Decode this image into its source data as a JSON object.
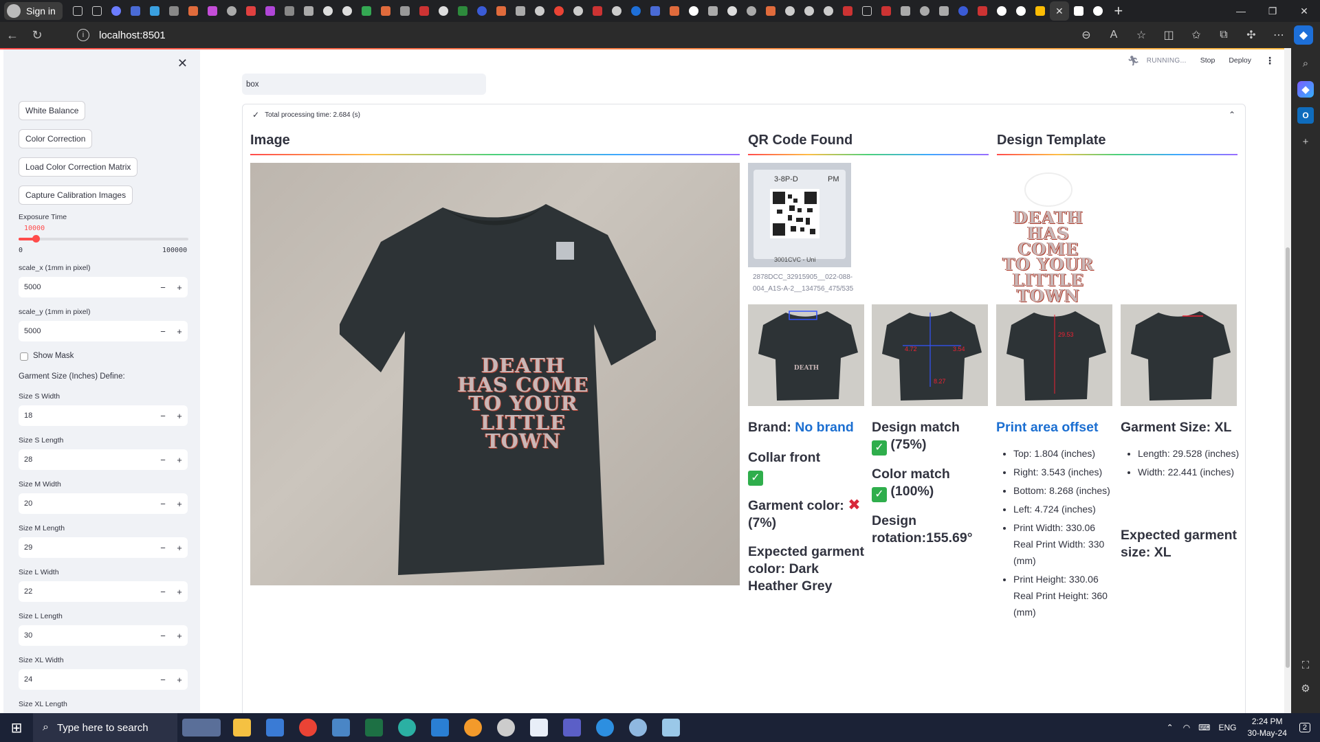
{
  "browser": {
    "sign_in": "Sign in",
    "url": "localhost:8501",
    "new_tab": "+"
  },
  "app": {
    "status": "RUNNING...",
    "stop": "Stop",
    "deploy": "Deploy",
    "search_value": "box",
    "processing_time": "Total processing time: 2.684 (s)"
  },
  "sidebar": {
    "buttons": [
      "White Balance",
      "Color Correction",
      "Load Color Correction Matrix",
      "Capture Calibration Images"
    ],
    "exposure_label": "Exposure Time",
    "exposure_value": "10000",
    "exposure_min": "0",
    "exposure_max": "100000",
    "exposure_fraction": 0.1,
    "scale_x_label": "scale_x (1mm in pixel)",
    "scale_x_value": "5000",
    "scale_y_label": "scale_y (1mm in pixel)",
    "scale_y_value": "5000",
    "show_mask": "Show Mask",
    "garment_section": "Garment Size (Inches) Define:",
    "sizes": [
      {
        "label": "Size S Width",
        "value": "18"
      },
      {
        "label": "Size S Length",
        "value": "28"
      },
      {
        "label": "Size M Width",
        "value": "20"
      },
      {
        "label": "Size M Length",
        "value": "29"
      },
      {
        "label": "Size L Width",
        "value": "22"
      },
      {
        "label": "Size L Length",
        "value": "30"
      },
      {
        "label": "Size XL Width",
        "value": "24"
      }
    ],
    "size_xl_length_label": "Size XL Length"
  },
  "columns": {
    "image": "Image",
    "qr": "QR Code Found",
    "template": "Design Template"
  },
  "qr_caption": "2878DCC_32915905__022-088-004_A1S-A-2__134756_475/535",
  "qr_text_top": "3-8P-D",
  "qr_text_pm": "PM",
  "qr_text_bottom": "3001CVC - Uni",
  "print_lines": [
    "DEATH",
    "HAS COME",
    "TO YOUR",
    "LITTLE TOWN"
  ],
  "thumb_labels": {
    "t2_a": "4.72",
    "t2_b": "3.54",
    "t2_c": "8.27",
    "t3_a": "29.53"
  },
  "results": {
    "brand_label": "Brand:",
    "brand_value": "No brand",
    "collar": "Collar front",
    "garment_color": "Garment color:",
    "garment_color_pct": "(7%)",
    "expected_color": "Expected garment color: Dark Heather Grey",
    "design_match": "Design match",
    "design_match_pct": "(75%)",
    "color_match": "Color match",
    "color_match_pct": "(100%)",
    "design_rotation": "Design rotation:155.69°",
    "print_offset_title": "Print area offset",
    "offsets": [
      "Top: 1.804 (inches)",
      "Right: 3.543 (inches)",
      "Bottom: 8.268 (inches)",
      "Left: 4.724 (inches)",
      "Print Width: 330.06 Real Print Width: 330 (mm)",
      "Print Height: 330.06 Real Print Height: 360 (mm)"
    ],
    "garment_size_title": "Garment Size: XL",
    "garment_dims": [
      "Length: 29.528 (inches)",
      "Width: 22.441 (inches)"
    ],
    "expected_size": "Expected garment size: XL"
  },
  "taskbar": {
    "search": "Type here to search",
    "lang": "ENG",
    "time": "2:24 PM",
    "date": "30-May-24",
    "notif": "2"
  }
}
